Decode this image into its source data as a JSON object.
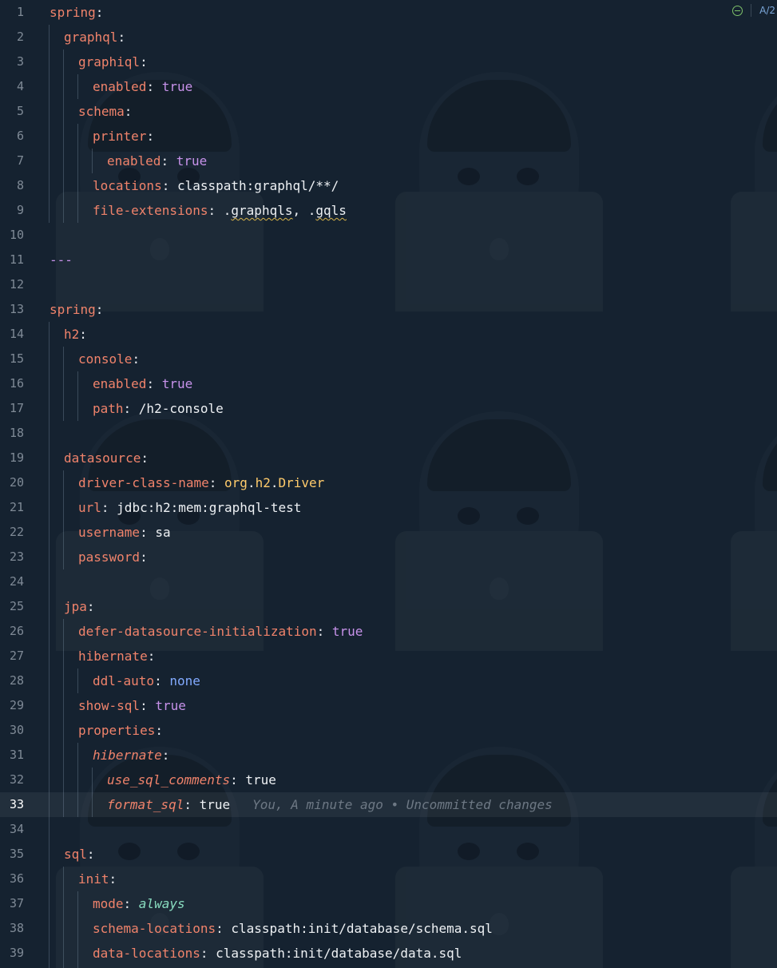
{
  "editor": {
    "current_line": "33",
    "toolbar": {
      "spell_label": "A/2"
    },
    "blame": "You, A minute ago • Uncommitted changes",
    "line_numbers": [
      "1",
      "2",
      "3",
      "4",
      "5",
      "6",
      "7",
      "8",
      "9",
      "10",
      "11",
      "12",
      "13",
      "14",
      "15",
      "16",
      "17",
      "18",
      "19",
      "20",
      "21",
      "22",
      "23",
      "24",
      "25",
      "26",
      "27",
      "28",
      "29",
      "30",
      "31",
      "32",
      "33",
      "34",
      "35",
      "36",
      "37",
      "38",
      "39"
    ],
    "lines": {
      "l1": {
        "key": "spring"
      },
      "l2": {
        "key": "graphql"
      },
      "l3": {
        "key": "graphiql"
      },
      "l4": {
        "key": "enabled",
        "value": "true"
      },
      "l5": {
        "key": "schema"
      },
      "l6": {
        "key": "printer"
      },
      "l7": {
        "key": "enabled",
        "value": "true"
      },
      "l8": {
        "key": "locations",
        "value": "classpath:graphql/**/"
      },
      "l9": {
        "key": "file-extensions",
        "v1": ".",
        "v2": "graphqls",
        "v3": ", .",
        "v4": "gqls"
      },
      "l11": {
        "text": "---"
      },
      "l13": {
        "key": "spring"
      },
      "l14": {
        "key": "h2"
      },
      "l15": {
        "key": "console"
      },
      "l16": {
        "key": "enabled",
        "value": "true"
      },
      "l17": {
        "key": "path",
        "value": "/h2-console"
      },
      "l19": {
        "key": "datasource"
      },
      "l20": {
        "key": "driver-class-name",
        "v1": "org",
        "v2": ".",
        "v3": "h2",
        "v4": ".",
        "v5": "Driver"
      },
      "l21": {
        "key": "url",
        "value": "jdbc:h2:mem:graphql-test"
      },
      "l22": {
        "key": "username",
        "value": "sa"
      },
      "l23": {
        "key": "password"
      },
      "l25": {
        "key": "jpa"
      },
      "l26": {
        "key": "defer-datasource-initialization",
        "value": "true"
      },
      "l27": {
        "key": "hibernate"
      },
      "l28": {
        "key": "ddl-auto",
        "value": "none"
      },
      "l29": {
        "key": "show-sql",
        "value": "true"
      },
      "l30": {
        "key": "properties"
      },
      "l31": {
        "key": "hibernate"
      },
      "l32": {
        "key": "use_sql_comments",
        "value": "true"
      },
      "l33": {
        "key": "format_sql",
        "value": "true"
      },
      "l35": {
        "key": "sql"
      },
      "l36": {
        "key": "init"
      },
      "l37": {
        "key": "mode",
        "value": "always"
      },
      "l38": {
        "key": "schema-locations",
        "value": "classpath:init/database/schema.sql"
      },
      "l39": {
        "key": "data-locations",
        "value": "classpath:init/database/data.sql"
      }
    }
  },
  "colors": {
    "background": "#152230",
    "key": "#f0836b",
    "boolean": "#c792ea",
    "null_like": "#82aaff",
    "anchor_value": "#89ddc0",
    "class_name": "#ffcb6b"
  }
}
